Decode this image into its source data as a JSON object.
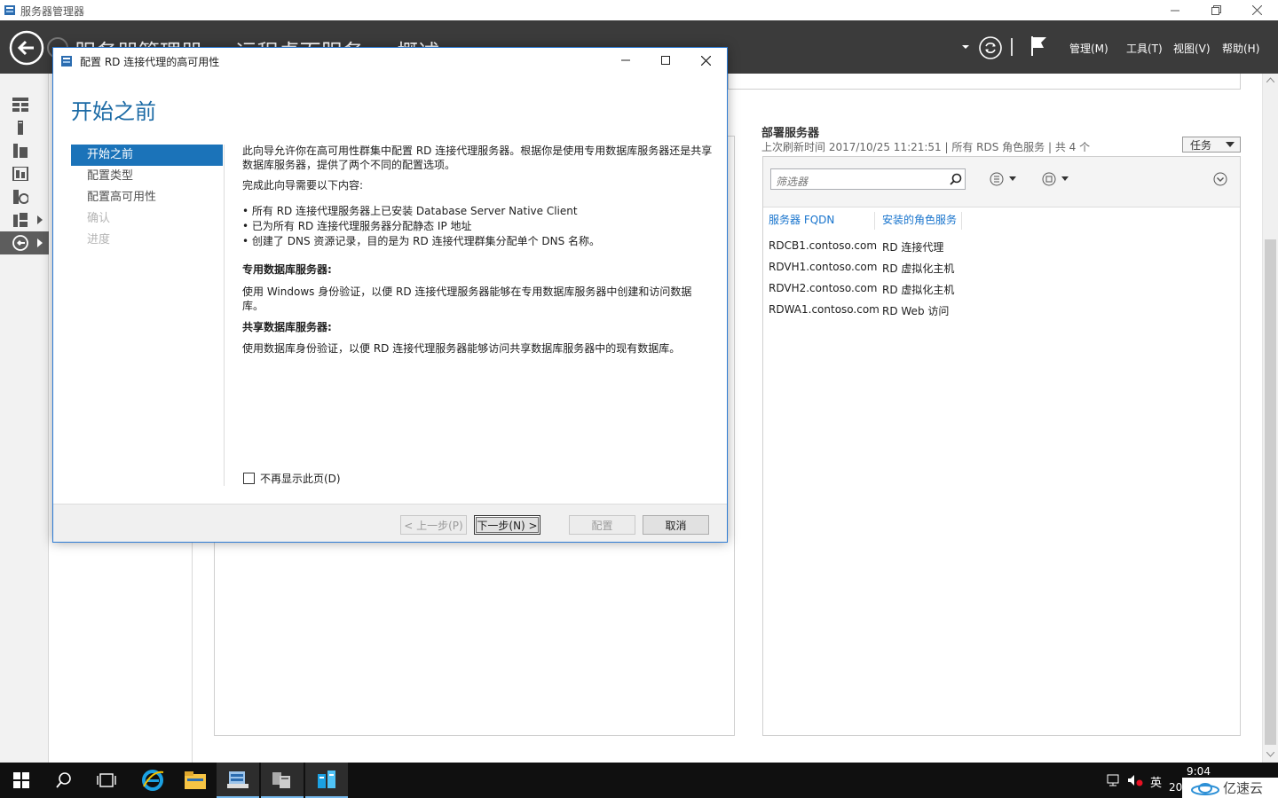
{
  "app": {
    "window_title": "服务器管理器",
    "breadcrumb": [
      "服务器管理器",
      "远程桌面服务",
      "概述"
    ],
    "menu": {
      "manage": "管理(M)",
      "tools": "工具(T)",
      "view": "视图(V)",
      "help": "帮助(H)"
    }
  },
  "deploy": {
    "title": "部署服务器",
    "subtitle": "上次刷新时间 2017/10/25 11:21:51 | 所有 RDS 角色服务 | 共 4 个",
    "tasks_label": "任务",
    "filter_placeholder": "筛选器",
    "columns": {
      "fqdn": "服务器 FQDN",
      "role": "安装的角色服务"
    },
    "rows": [
      {
        "fqdn": "RDCB1.contoso.com",
        "role": "RD 连接代理"
      },
      {
        "fqdn": "RDVH1.contoso.com",
        "role": "RD 虚拟化主机"
      },
      {
        "fqdn": "RDVH2.contoso.com",
        "role": "RD 虚拟化主机"
      },
      {
        "fqdn": "RDWA1.contoso.com",
        "role": "RD Web 访问"
      }
    ]
  },
  "dialog": {
    "title": "配置 RD 连接代理的高可用性",
    "heading": "开始之前",
    "steps": [
      {
        "label": "开始之前",
        "state": "current"
      },
      {
        "label": "配置类型",
        "state": "enabled"
      },
      {
        "label": "配置高可用性",
        "state": "enabled"
      },
      {
        "label": "确认",
        "state": "disabled"
      },
      {
        "label": "进度",
        "state": "disabled"
      }
    ],
    "intro": "此向导允许你在高可用性群集中配置 RD 连接代理服务器。根据你是使用专用数据库服务器还是共享数据库服务器，提供了两个不同的配置选项。",
    "prereq_title": "完成此向导需要以下内容:",
    "bullets": [
      "所有 RD 连接代理服务器上已安装 Database Server Native Client",
      "已为所有 RD 连接代理服务器分配静态 IP 地址",
      "创建了 DNS 资源记录，目的是为 RD 连接代理群集分配单个 DNS 名称。"
    ],
    "dedicated_title": "专用数据库服务器:",
    "dedicated_text": "使用 Windows 身份验证，以便 RD 连接代理服务器能够在专用数据库服务器中创建和访问数据库。",
    "shared_title": "共享数据库服务器:",
    "shared_text": "使用数据库身份验证，以便 RD 连接代理服务器能够访问共享数据库服务器中的现有数据库。",
    "checkbox_label": "不再显示此页(D)",
    "buttons": {
      "prev": "< 上一步(P)",
      "next": "下一步(N) >",
      "configure": "配置",
      "cancel": "取消"
    }
  },
  "taskbar": {
    "time": "9:04",
    "date_partial": "20",
    "ime": "英"
  },
  "watermark": "亿速云"
}
